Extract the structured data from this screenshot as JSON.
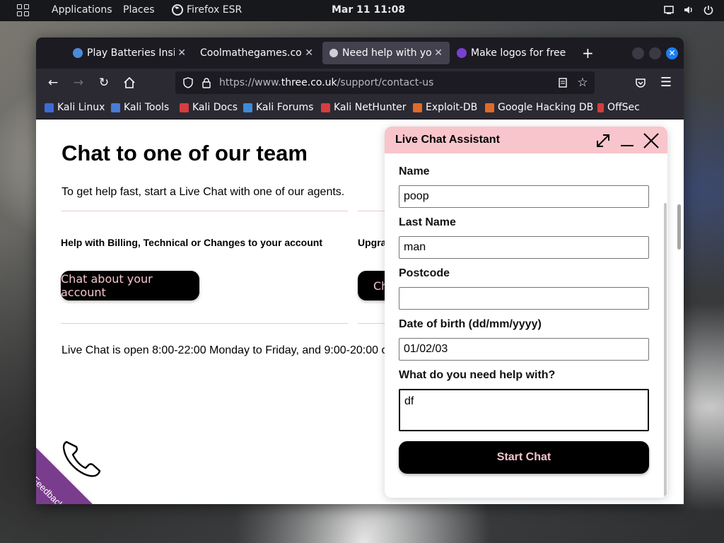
{
  "top_panel": {
    "applications": "Applications",
    "places": "Places",
    "app_name": "Firefox ESR",
    "clock": "Mar 11  11:08"
  },
  "tabs": [
    {
      "title": "Play Batteries Inside Game",
      "favicon_color": "#4a8bd6"
    },
    {
      "title": "Coolmathegames.com",
      "favicon_color": ""
    },
    {
      "title": "Need help with your",
      "favicon_color": "#cfcfd8"
    },
    {
      "title": "Make logos for free",
      "favicon_color": "#7b3fd0"
    }
  ],
  "navbar": {
    "url_prefix": "https://www.",
    "url_domain": "three.co.uk",
    "url_path": "/support/contact-us"
  },
  "bookmarks": [
    {
      "label": "Kali Linux",
      "color": "#3d6bd6"
    },
    {
      "label": "Kali Tools",
      "color": "#4a7bd6"
    },
    {
      "label": "Kali Docs",
      "color": "#d63d3d"
    },
    {
      "label": "Kali Forums",
      "color": "#3d8bd6"
    },
    {
      "label": "Kali NetHunter",
      "color": "#d63d3d"
    },
    {
      "label": "Exploit-DB",
      "color": "#e06a2a"
    },
    {
      "label": "Google Hacking DB",
      "color": "#e06a2a"
    },
    {
      "label": "OffSec",
      "color": "#d63d3d"
    }
  ],
  "page": {
    "heading": "Chat to one of our team",
    "intro": "To get help fast, start a Live Chat with one of our agents.",
    "help_heading": "Help with Billing, Technical or Changes to your account",
    "upgrade_heading": "Upgra",
    "chat_account_button": "Chat about your account",
    "upgrade_button": "Ch",
    "hours": "Live Chat is open 8:00-22:00 Monday to Friday, and 9:00-20:00 o",
    "feedback": "Feedback"
  },
  "chat": {
    "title": "Live Chat Assistant",
    "name_label": "Name",
    "name_value": "poop",
    "last_name_label": "Last Name",
    "last_name_value": "man",
    "postcode_label": "Postcode",
    "postcode_value": "",
    "dob_label": "Date of birth (dd/mm/yyyy)",
    "dob_value": "01/02/03",
    "help_label": "What do you need help with?",
    "help_value": "df",
    "start_button": "Start Chat"
  },
  "colors": {
    "brand_pink": "#f8c5cc",
    "button_black": "#000000",
    "button_text_pink": "#f6c5cd",
    "feedback_purple": "#7a3c8d"
  }
}
